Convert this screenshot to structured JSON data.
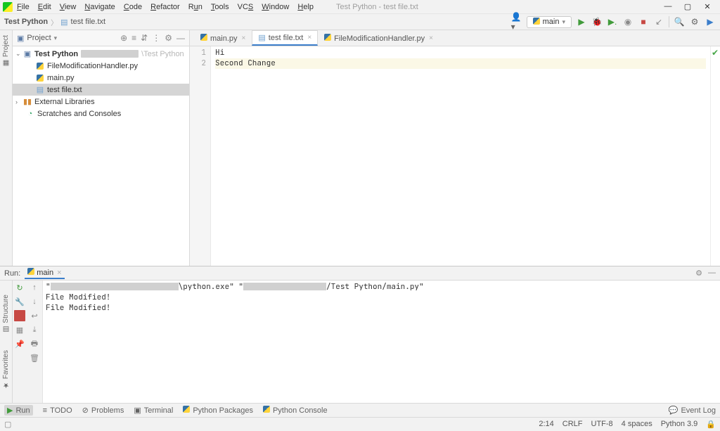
{
  "menu": {
    "items": [
      "File",
      "Edit",
      "View",
      "Navigate",
      "Code",
      "Refactor",
      "Run",
      "Tools",
      "VCS",
      "Window",
      "Help"
    ],
    "title": "Test Python - test file.txt"
  },
  "breadcrumb": {
    "project": "Test Python",
    "file": "test file.txt"
  },
  "runconfig": {
    "selected": "main"
  },
  "project": {
    "label": "Project",
    "root": {
      "name": "Test Python",
      "path_suffix": "\\Test Python"
    },
    "files": [
      "FileModificationHandler.py",
      "main.py",
      "test file.txt"
    ],
    "external": "External Libraries",
    "scratches": "Scratches and Consoles"
  },
  "tabs": [
    {
      "label": "main.py",
      "active": false
    },
    {
      "label": "test file.txt",
      "active": true
    },
    {
      "label": "FileModificationHandler.py",
      "active": false
    }
  ],
  "editor": {
    "lines": [
      "Hi",
      "Second Change"
    ]
  },
  "run": {
    "label": "Run:",
    "tab": "main",
    "cmd_mid": "\\python.exe\"  \"",
    "cmd_suffix": "/Test Python/main.py\"",
    "out1": "File Modified!",
    "out2": "File Modified!"
  },
  "bottom_tabs": {
    "run": "Run",
    "todo": "TODO",
    "problems": "Problems",
    "terminal": "Terminal",
    "pypackages": "Python Packages",
    "pyconsole": "Python Console",
    "eventlog": "Event Log"
  },
  "status": {
    "pos": "2:14",
    "sep1": "CRLF",
    "enc": "UTF-8",
    "indent": "4 spaces",
    "interp": "Python 3.9"
  },
  "left_tabs": {
    "project": "Project",
    "structure": "Structure",
    "favorites": "Favorites"
  }
}
